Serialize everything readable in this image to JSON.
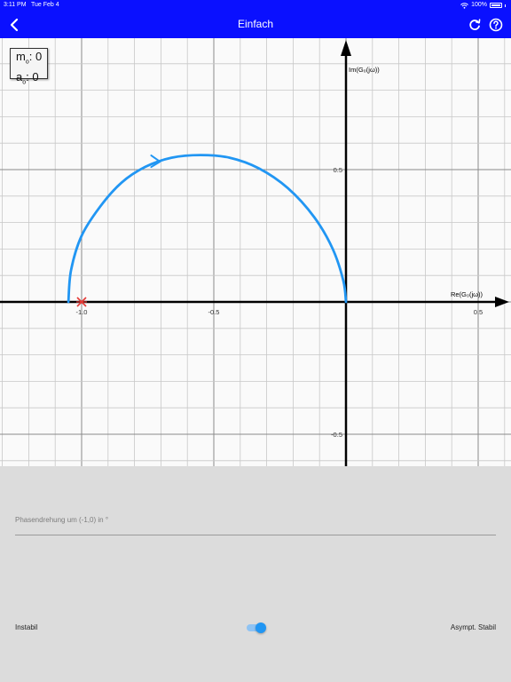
{
  "status_bar": {
    "time": "3:11 PM",
    "date": "Tue Feb 4",
    "battery": "100%"
  },
  "app_bar": {
    "title": "Einfach",
    "back_icon": "chevron-left-icon",
    "refresh_icon": "refresh-icon",
    "help_icon": "help-circle-icon"
  },
  "counters": {
    "m_label": "m",
    "m_sub": "o",
    "m_value": ": 0",
    "a_label": "a",
    "a_sub": "o",
    "a_value": ": 0"
  },
  "plot": {
    "x_axis_label": "Re(G₀(jω))",
    "y_axis_label": "Im(G₀(jω))",
    "x_ticks": [
      "-1.0",
      "-0.5",
      "0.5"
    ],
    "y_ticks": [
      "0.5",
      "-0.5"
    ],
    "curve_color": "#2196f3",
    "critical_point_color": "#e53935"
  },
  "chart_data": {
    "type": "line",
    "title": "",
    "xlabel": "Re(G₀(jω))",
    "ylabel": "Im(G₀(jω))",
    "xlim": [
      -1.3,
      0.62
    ],
    "ylim": [
      -0.62,
      0.98
    ],
    "grid": true,
    "critical_point": {
      "x": -1.0,
      "y": 0.0,
      "marker": "x"
    },
    "series": [
      {
        "x": [
          -1.05,
          -1.04,
          -1.0,
          -0.93,
          -0.85,
          -0.76,
          -0.66,
          -0.55,
          -0.44,
          -0.33,
          -0.22,
          -0.12,
          -0.05,
          -0.01,
          0.0
        ],
        "y": [
          0.0,
          0.12,
          0.25,
          0.36,
          0.45,
          0.51,
          0.545,
          0.555,
          0.545,
          0.505,
          0.43,
          0.32,
          0.2,
          0.08,
          0.0
        ]
      }
    ],
    "direction_arrow": {
      "x": -0.72,
      "y": 0.53
    }
  },
  "fab": {
    "icon": "check-icon"
  },
  "bottom": {
    "phase_label": "Phasendrehung um (-1,0) in °",
    "left_label": "Instabil",
    "right_label": "Asympt. Stabil",
    "toggle_on": true
  }
}
